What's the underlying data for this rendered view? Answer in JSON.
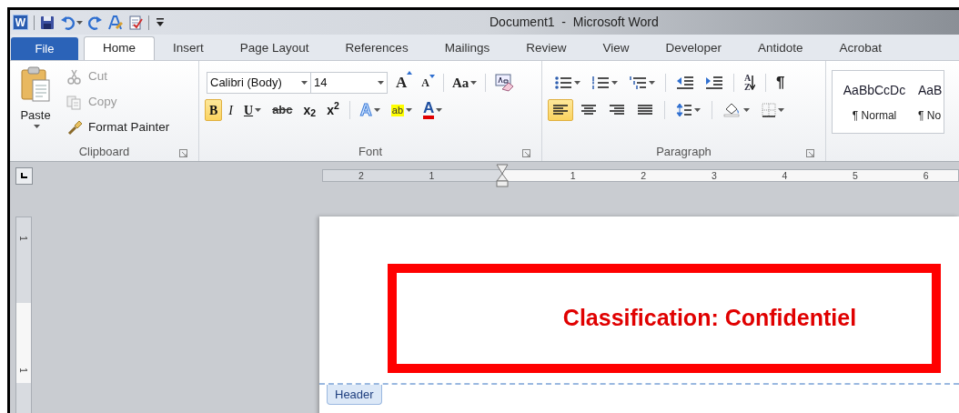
{
  "app_icon": {
    "label": "W"
  },
  "quick_access": [
    {
      "kind": "save",
      "dropdown": false
    },
    {
      "kind": "undo",
      "dropdown": true
    },
    {
      "kind": "redo",
      "dropdown": false
    },
    {
      "kind": "spelling",
      "dropdown": false
    },
    {
      "kind": "document",
      "dropdown": false
    },
    {
      "kind": "customize",
      "dropdown": false
    }
  ],
  "window": {
    "title": "Document1  -  Microsoft Word"
  },
  "tabs": [
    {
      "label": "File",
      "kind": "file",
      "selected": false
    },
    {
      "label": "Home",
      "kind": "tab",
      "selected": true
    },
    {
      "label": "Insert",
      "kind": "tab",
      "selected": false
    },
    {
      "label": "Page Layout",
      "kind": "tab",
      "selected": false
    },
    {
      "label": "References",
      "kind": "tab",
      "selected": false
    },
    {
      "label": "Mailings",
      "kind": "tab",
      "selected": false
    },
    {
      "label": "Review",
      "kind": "tab",
      "selected": false
    },
    {
      "label": "View",
      "kind": "tab",
      "selected": false
    },
    {
      "label": "Developer",
      "kind": "tab",
      "selected": false
    },
    {
      "label": "Antidote",
      "kind": "tab",
      "selected": false
    },
    {
      "label": "Acrobat",
      "kind": "tab",
      "selected": false
    }
  ],
  "clipboard": {
    "title": "Clipboard",
    "paste": "Paste",
    "items": [
      {
        "kind": "cut",
        "label": "Cut",
        "disabled": true
      },
      {
        "kind": "copy",
        "label": "Copy",
        "disabled": true
      },
      {
        "kind": "painter",
        "label": "Format Painter",
        "disabled": false
      }
    ]
  },
  "font": {
    "title": "Font",
    "font_name": "Calibri (Body)",
    "font_size": "14",
    "row1": [
      {
        "kind": "grow",
        "label": "A",
        "pressed": false,
        "dropdown": false
      },
      {
        "kind": "shrink",
        "label": "A",
        "pressed": false,
        "dropdown": false
      },
      {
        "kind": "sep"
      },
      {
        "kind": "case",
        "label": "Aa",
        "pressed": false,
        "dropdown": true
      },
      {
        "kind": "sep"
      },
      {
        "kind": "clear",
        "pressed": false,
        "dropdown": false
      }
    ],
    "row2": [
      {
        "kind": "bold",
        "label": "B",
        "pressed": true,
        "dropdown": false
      },
      {
        "kind": "italic",
        "label": "I",
        "pressed": false,
        "dropdown": false
      },
      {
        "kind": "underline",
        "label": "U",
        "pressed": false,
        "dropdown": true
      },
      {
        "kind": "strike",
        "label": "abc",
        "pressed": false,
        "dropdown": false
      },
      {
        "kind": "script",
        "label": "x$_{2}$",
        "pressed": false,
        "dropdown": false
      },
      {
        "kind": "script",
        "label": "x$^{2}$",
        "pressed": false,
        "dropdown": false
      },
      {
        "kind": "sep"
      },
      {
        "kind": "effects",
        "label": "A",
        "pressed": false,
        "dropdown": true
      },
      {
        "kind": "highlight",
        "label": "ab",
        "pressed": false,
        "dropdown": true
      },
      {
        "kind": "color",
        "label": "A",
        "pressed": false,
        "dropdown": true
      }
    ]
  },
  "paragraph": {
    "title": "Paragraph",
    "row1": [
      {
        "kind": "bullets",
        "pressed": false,
        "dropdown": true
      },
      {
        "kind": "numbering",
        "pressed": false,
        "dropdown": true
      },
      {
        "kind": "multilevel",
        "pressed": false,
        "dropdown": true
      },
      {
        "kind": "sep"
      },
      {
        "kind": "outdent",
        "pressed": false,
        "dropdown": false
      },
      {
        "kind": "indent",
        "pressed": false,
        "dropdown": false
      },
      {
        "kind": "sep"
      },
      {
        "kind": "sort",
        "label": "AZ",
        "pressed": false,
        "dropdown": false
      },
      {
        "kind": "sep"
      },
      {
        "kind": "marks",
        "label": "¶",
        "pressed": false,
        "dropdown": false
      }
    ],
    "row2": [
      {
        "kind": "align-left",
        "pressed": true,
        "dropdown": false
      },
      {
        "kind": "align-center",
        "pressed": false,
        "dropdown": false
      },
      {
        "kind": "align-right",
        "pressed": false,
        "dropdown": false
      },
      {
        "kind": "justify",
        "pressed": false,
        "dropdown": false
      },
      {
        "kind": "sep"
      },
      {
        "kind": "spacing",
        "pressed": false,
        "dropdown": true
      },
      {
        "kind": "sep"
      },
      {
        "kind": "shading",
        "pressed": false,
        "dropdown": true
      },
      {
        "kind": "borders",
        "pressed": false,
        "dropdown": true
      }
    ]
  },
  "styles": [
    {
      "preview": "AaBbCcDc",
      "label": "¶ Normal"
    },
    {
      "preview": "AaB",
      "label": "¶ No"
    }
  ],
  "ruler": {
    "left_labels": [
      "2",
      "1"
    ],
    "right_labels": [
      "1",
      "2",
      "3",
      "4",
      "5",
      "6"
    ]
  },
  "vertical_ruler": {
    "labels": [
      "1",
      "1"
    ]
  },
  "document": {
    "header_text": "Classification: Confidentiel",
    "header_label": "Header"
  }
}
